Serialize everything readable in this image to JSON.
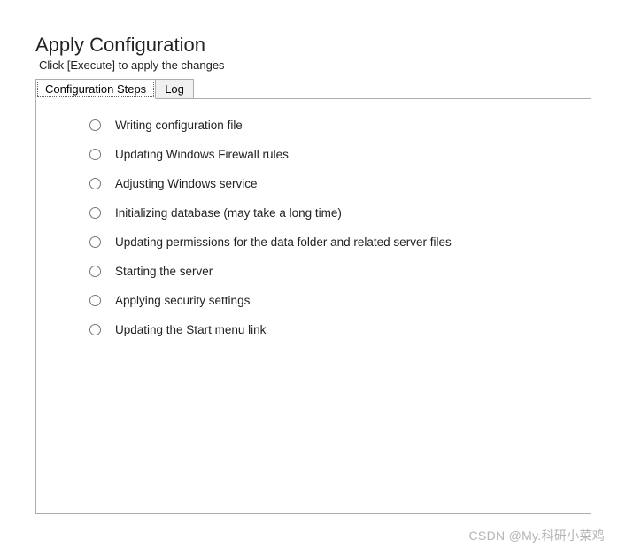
{
  "header": {
    "title": "Apply Configuration",
    "subtitle": "Click [Execute] to apply the changes"
  },
  "tabs": {
    "active": "Configuration Steps",
    "inactive": "Log"
  },
  "steps": [
    "Writing configuration file",
    "Updating Windows Firewall rules",
    "Adjusting Windows service",
    "Initializing database (may take a long time)",
    "Updating permissions for the data folder and related server files",
    "Starting the server",
    "Applying security settings",
    "Updating the Start menu link"
  ],
  "watermark": "CSDN @My.科研小菜鸡"
}
